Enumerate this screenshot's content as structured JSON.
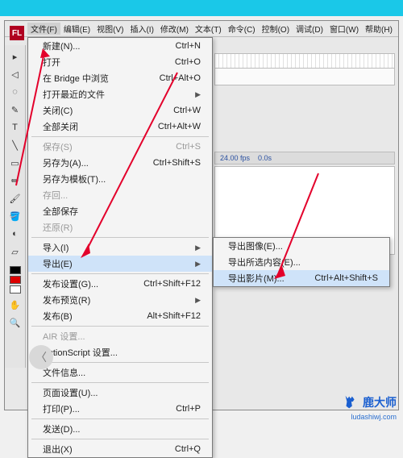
{
  "menubar": {
    "items": [
      "文件(F)",
      "编辑(E)",
      "视图(V)",
      "插入(I)",
      "修改(M)",
      "文本(T)",
      "命令(C)",
      "控制(O)",
      "调试(D)",
      "窗口(W)",
      "帮助(H)"
    ],
    "active_index": 0
  },
  "file_menu": {
    "new": "新建(N)...",
    "new_sc": "Ctrl+N",
    "open": "打开",
    "open_sc": "Ctrl+O",
    "bridge": "在 Bridge 中浏览",
    "bridge_sc": "Ctrl+Alt+O",
    "recent": "打开最近的文件",
    "close": "关闭(C)",
    "close_sc": "Ctrl+W",
    "close_all": "全部关闭",
    "close_all_sc": "Ctrl+Alt+W",
    "save": "保存(S)",
    "save_sc": "Ctrl+S",
    "save_as": "另存为(A)...",
    "save_as_sc": "Ctrl+Shift+S",
    "save_tpl": "另存为模板(T)...",
    "checkin": "存回...",
    "save_all": "全部保存",
    "revert": "还原(R)",
    "import": "导入(I)",
    "export": "导出(E)",
    "pub_set": "发布设置(G)...",
    "pub_set_sc": "Ctrl+Shift+F12",
    "pub_prev": "发布预览(R)",
    "publish": "发布(B)",
    "publish_sc": "Alt+Shift+F12",
    "air": "AIR 设置...",
    "as": "ActionScript 设置...",
    "fileinfo": "文件信息...",
    "page_set": "页面设置(U)...",
    "print": "打印(P)...",
    "print_sc": "Ctrl+P",
    "send": "发送(D)...",
    "exit": "退出(X)",
    "exit_sc": "Ctrl+Q"
  },
  "export_submenu": {
    "image": "导出图像(E)...",
    "selection": "导出所选内容(E)...",
    "movie": "导出影片(M)...",
    "movie_sc": "Ctrl+Alt+Shift+S"
  },
  "status": {
    "fps_label": "24.00 fps",
    "time_label": "0.0s"
  },
  "logo": {
    "brand": "鹿大师",
    "url": "ludashiwj.com"
  },
  "app_badge": "FL"
}
